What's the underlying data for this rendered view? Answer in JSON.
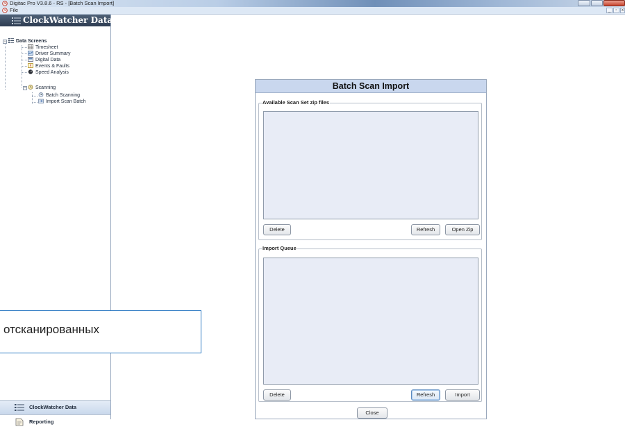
{
  "window": {
    "title": "Digitac Pro V3.8.6 - RS - [Batch Scan Import]",
    "menu_file": "File"
  },
  "sidebar": {
    "header": "ClockWatcher Data",
    "tree": {
      "root": "Data Screens",
      "items": [
        "Timesheet",
        "Driver Summary",
        "Digital Data",
        "Events & Faults",
        "Speed Analysis"
      ],
      "scanning": "Scanning",
      "scanning_children": [
        "Batch Scanning",
        "Import Scan Batch"
      ]
    },
    "nav": {
      "clockwatcher": "ClockWatcher Data",
      "reporting": "Reporting"
    }
  },
  "dialog": {
    "title": "Batch Scan Import",
    "available_group": {
      "label": "Available Scan Set zip files",
      "delete": "Delete",
      "refresh": "Refresh",
      "open_zip": "Open Zip"
    },
    "queue_group": {
      "label": "Import Queue",
      "delete": "Delete",
      "refresh": "Refresh",
      "import": "Import"
    },
    "close": "Close"
  },
  "callout": {
    "text": "отсканированных"
  },
  "colors": {
    "dialog_title_bg": "#c9d7ee",
    "listbox_bg": "#e8ecf6",
    "panel_header_bg": "#3a4a60",
    "callout_border": "#2b79c2"
  },
  "icons": [
    "app-icon",
    "file-menu-icon",
    "clockwatcher-header-icon",
    "data-screens-icon",
    "timesheet-icon",
    "driver-summary-icon",
    "digital-data-icon",
    "events-faults-icon",
    "speed-analysis-icon",
    "scanning-icon",
    "batch-scanning-icon",
    "import-scan-batch-icon",
    "reporting-icon"
  ]
}
